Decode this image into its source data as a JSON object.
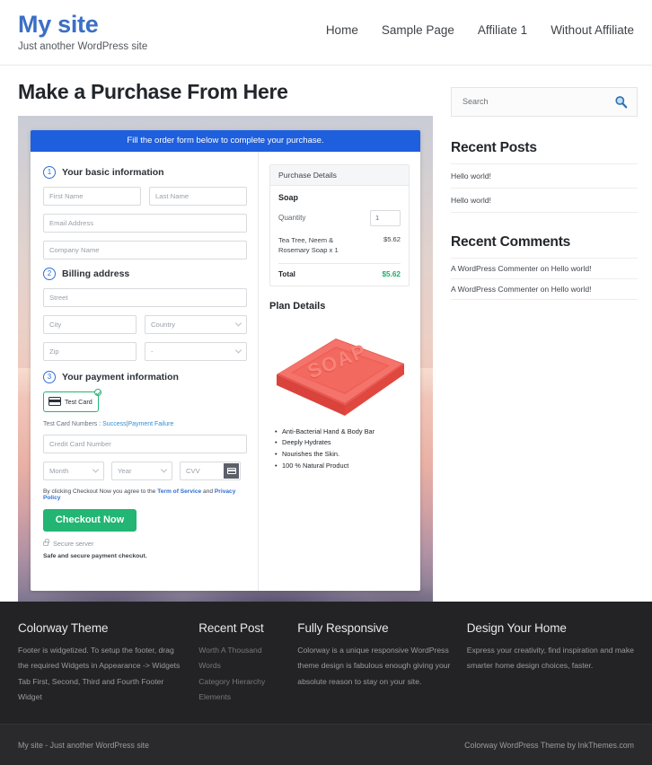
{
  "header": {
    "site_title": "My site",
    "tagline": "Just another WordPress site",
    "nav": [
      {
        "label": "Home"
      },
      {
        "label": "Sample Page"
      },
      {
        "label": "Affiliate 1"
      },
      {
        "label": "Without Affiliate"
      }
    ]
  },
  "main": {
    "page_title": "Make a Purchase From Here",
    "checkout": {
      "banner": "Fill the order form below to complete your purchase.",
      "step1": {
        "number": "1",
        "label": "Your basic information",
        "first_name_placeholder": "First Name",
        "last_name_placeholder": "Last Name",
        "email_placeholder": "Email Address",
        "company_placeholder": "Company Name"
      },
      "step2": {
        "number": "2",
        "label": "Billing address",
        "street_placeholder": "Street",
        "city_placeholder": "City",
        "country_placeholder": "Country",
        "zip_placeholder": "Zip",
        "state_placeholder": "-"
      },
      "step3": {
        "number": "3",
        "label": "Your payment information",
        "test_card_label": "Test  Card",
        "test_numbers_label": "Test Card Numbers :",
        "test_success_link": "Success",
        "test_separator": "|",
        "test_failure_link": "Payment Failure",
        "card_number_placeholder": "Credit Card Number",
        "month_placeholder": "Month",
        "year_placeholder": "Year",
        "cvv_placeholder": "CVV",
        "agree_prefix": "By clicking Checkout Now you agree to the",
        "terms_link": "Term of Service",
        "agree_and": "and",
        "privacy_link": "Privacy Policy",
        "checkout_button": "Checkout Now",
        "secure_server": "Secure server",
        "safe_note": "Safe and secure payment checkout."
      },
      "purchase_details": {
        "heading": "Purchase Details",
        "product": "Soap",
        "quantity_label": "Quantity",
        "quantity_value": "1",
        "line_item_name": "Tea Tree, Neem & Rosemary Soap x 1",
        "line_item_amount": "$5.62",
        "total_label": "Total",
        "total_amount": "$5.62"
      },
      "plan_details": {
        "heading": "Plan Details",
        "image_label": "SOAP",
        "features": [
          "Anti-Bacterial Hand & Body Bar",
          "Deeply Hydrates",
          "Nourishes the Skin.",
          "100 % Natural Product"
        ]
      }
    }
  },
  "sidebar": {
    "search": {
      "placeholder": "Search",
      "icon": "search-icon"
    },
    "recent_posts": {
      "title": "Recent Posts",
      "items": [
        "Hello world!",
        "Hello world!"
      ]
    },
    "recent_comments": {
      "title": "Recent Comments",
      "items": [
        "A WordPress Commenter on Hello world!",
        "A WordPress Commenter on Hello world!"
      ]
    }
  },
  "footer": {
    "columns": [
      {
        "title": "Colorway Theme",
        "text": "Footer is widgetized. To setup the footer, drag the required Widgets in Appearance -> Widgets Tab First, Second, Third and Fourth Footer Widget"
      },
      {
        "title": "Recent Post",
        "items": [
          "Worth A Thousand Words",
          "Category Hierarchy",
          "Elements"
        ]
      },
      {
        "title": "Fully Responsive",
        "text": "Colorway is a unique responsive WordPress theme design is fabulous enough giving your absolute reason to stay on your site."
      },
      {
        "title": "Design Your Home",
        "text": "Express your creativity, find inspiration and make smarter home design choices, faster."
      }
    ],
    "bottom_left": "My site - Just another WordPress site",
    "bottom_right": "Colorway WordPress Theme by InkThemes.com"
  },
  "colors": {
    "brand_blue": "#3b6fc4",
    "banner_blue": "#1e5fdd",
    "accent_green": "#22b573",
    "total_green": "#1fae68",
    "footer_dark": "#232325",
    "soap_red": "#ef6058"
  }
}
